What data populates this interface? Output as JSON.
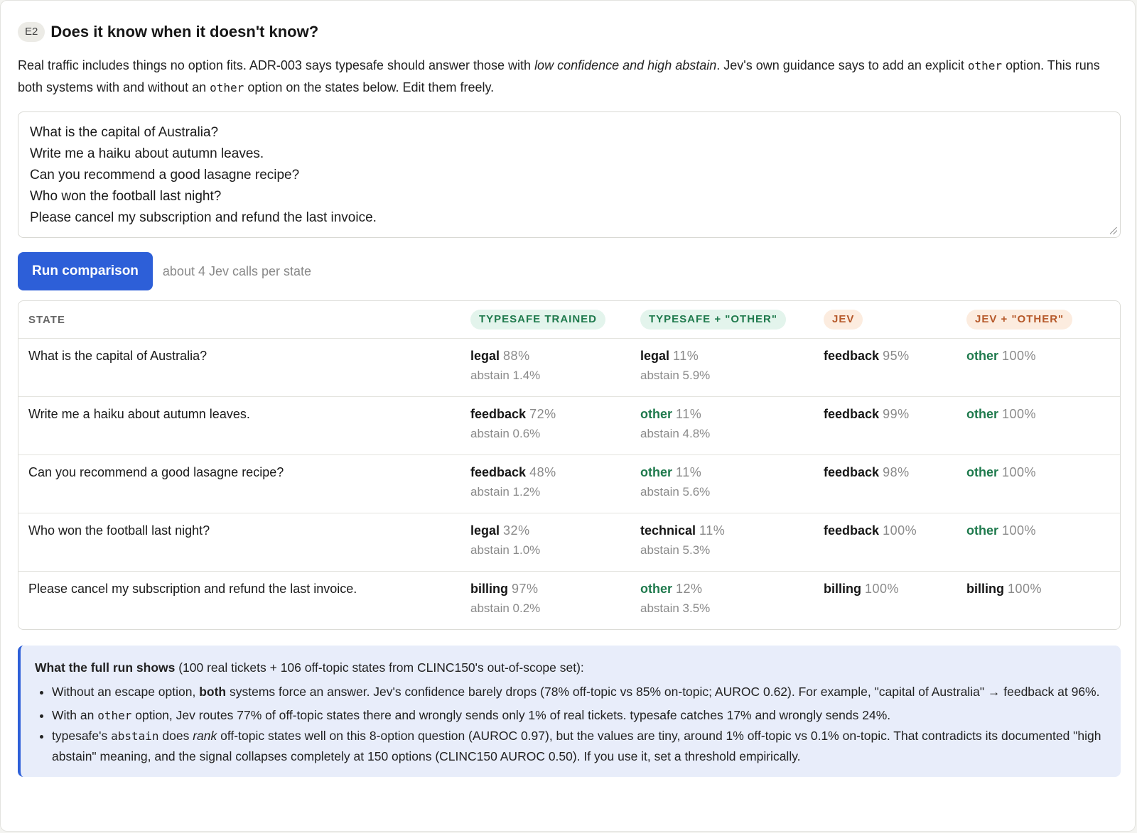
{
  "section": {
    "badge": "E2",
    "title": "Does it know when it doesn't know?"
  },
  "intro": {
    "p1": "Real traffic includes things no option fits. ADR-003 says typesafe should answer those with ",
    "em1": "low confidence and high abstain",
    "p2": ". Jev's own guidance says to add an explicit ",
    "code1": "other",
    "p3": " option. This runs both systems with and without an ",
    "code2": "other",
    "p4": " option on the states below. Edit them freely."
  },
  "states_input": {
    "lines": [
      "What is the capital of Australia?",
      "Write me a haiku about autumn leaves.",
      "Can you recommend a good lasagne recipe?",
      "Who won the football last night?",
      "Please cancel my subscription and refund the last invoice."
    ]
  },
  "run": {
    "button_label": "Run comparison",
    "hint": "about 4 Jev calls per state"
  },
  "table": {
    "headers": {
      "state": "STATE",
      "typesafe_trained": "TYPESAFE TRAINED",
      "typesafe_other": "TYPESAFE + \"OTHER\"",
      "jev": "JEV",
      "jev_other": "JEV + \"OTHER\""
    },
    "rows": [
      {
        "state": "What is the capital of Australia?",
        "ts": {
          "label": "legal",
          "pct": "88%",
          "abstain": "abstain 1.4%"
        },
        "tso": {
          "label": "legal",
          "pct": "11%",
          "abstain": "abstain 5.9%"
        },
        "jev": {
          "label": "feedback",
          "pct": "95%"
        },
        "jevo": {
          "label": "other",
          "pct": "100%"
        }
      },
      {
        "state": "Write me a haiku about autumn leaves.",
        "ts": {
          "label": "feedback",
          "pct": "72%",
          "abstain": "abstain 0.6%"
        },
        "tso": {
          "label": "other",
          "pct": "11%",
          "abstain": "abstain 4.8%"
        },
        "jev": {
          "label": "feedback",
          "pct": "99%"
        },
        "jevo": {
          "label": "other",
          "pct": "100%"
        }
      },
      {
        "state": "Can you recommend a good lasagne recipe?",
        "ts": {
          "label": "feedback",
          "pct": "48%",
          "abstain": "abstain 1.2%"
        },
        "tso": {
          "label": "other",
          "pct": "11%",
          "abstain": "abstain 5.6%"
        },
        "jev": {
          "label": "feedback",
          "pct": "98%"
        },
        "jevo": {
          "label": "other",
          "pct": "100%"
        }
      },
      {
        "state": "Who won the football last night?",
        "ts": {
          "label": "legal",
          "pct": "32%",
          "abstain": "abstain 1.0%"
        },
        "tso": {
          "label": "technical",
          "pct": "11%",
          "abstain": "abstain 5.3%"
        },
        "jev": {
          "label": "feedback",
          "pct": "100%"
        },
        "jevo": {
          "label": "other",
          "pct": "100%"
        }
      },
      {
        "state": "Please cancel my subscription and refund the last invoice.",
        "ts": {
          "label": "billing",
          "pct": "97%",
          "abstain": "abstain 0.2%"
        },
        "tso": {
          "label": "other",
          "pct": "12%",
          "abstain": "abstain 3.5%"
        },
        "jev": {
          "label": "billing",
          "pct": "100%"
        },
        "jevo": {
          "label": "billing",
          "pct": "100%"
        }
      }
    ]
  },
  "notes": {
    "head_bold": "What the full run shows",
    "head_rest": " (100 real tickets + 106 off-topic states from CLINC150's out-of-scope set):",
    "b1_a": "Without an escape option, ",
    "b1_bold": "both",
    "b1_b": " systems force an answer. Jev's confidence barely drops (78% off-topic vs 85% on-topic; AUROC 0.62). For example, \"capital of Australia\" → feedback at 96%.",
    "b2_a": "With an ",
    "b2_code": "other",
    "b2_b": " option, Jev routes 77% of off-topic states there and wrongly sends only 1% of real tickets. typesafe catches 17% and wrongly sends 24%.",
    "b3_a": "typesafe's ",
    "b3_code": "abstain",
    "b3_b": " does ",
    "b3_em": "rank",
    "b3_c": " off-topic states well on this 8-option question (AUROC 0.97), but the values are tiny, around 1% off-topic vs 0.1% on-topic. That contradicts its documented \"high abstain\" meaning, and the signal collapses completely at 150 options (CLINC150 AUROC 0.50). If you use it, set a threshold empirically."
  },
  "colors": {
    "accent": "#2d5fd8",
    "other_green": "#1f7a4d",
    "jev_orange": "#b6592a",
    "notes_bg": "#e8edfa"
  }
}
